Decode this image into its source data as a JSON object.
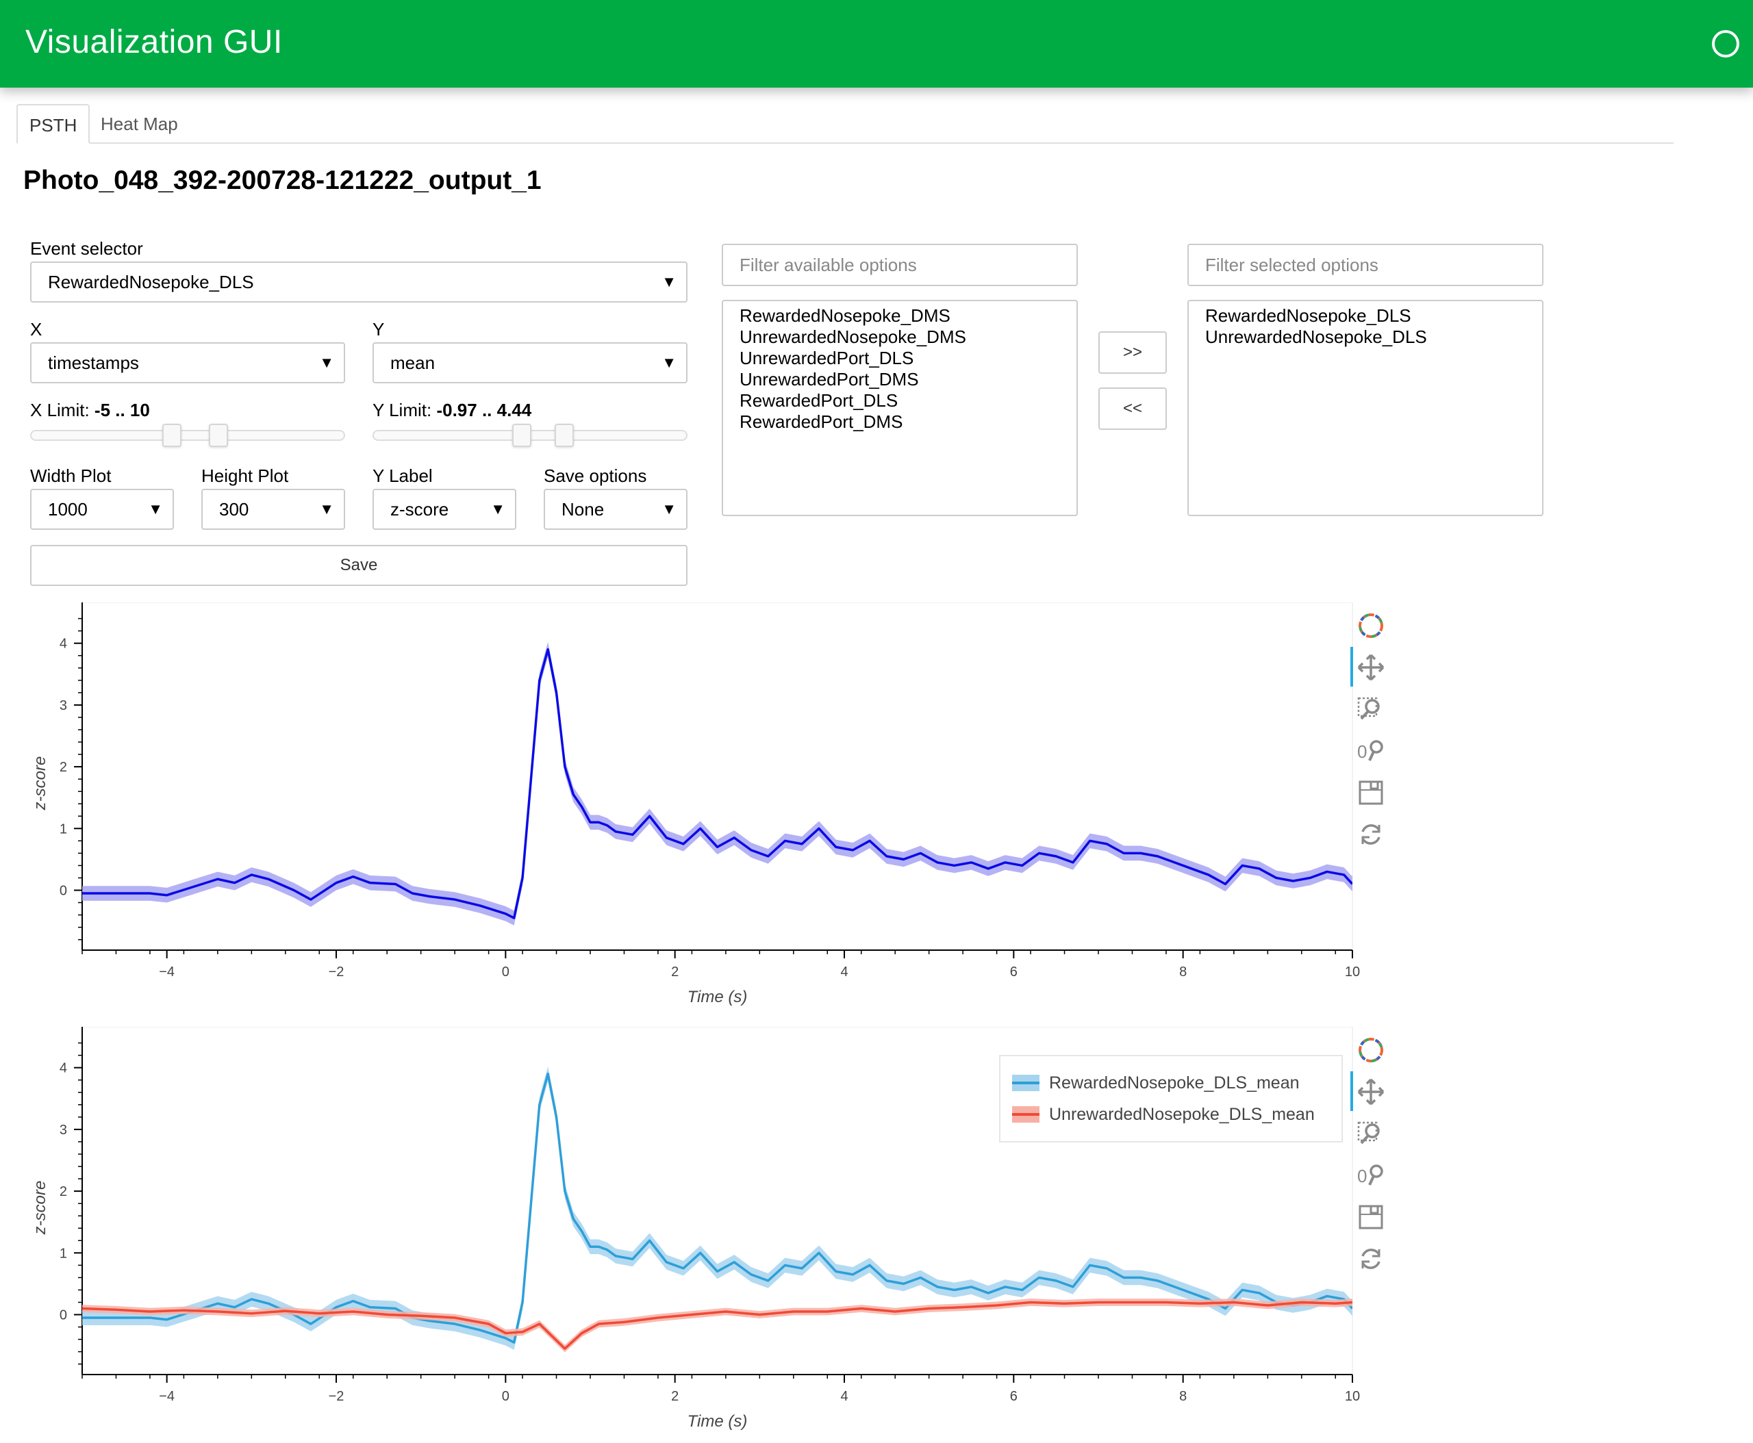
{
  "app": {
    "title": "Visualization GUI"
  },
  "tabs": [
    {
      "label": "PSTH"
    },
    {
      "label": "Heat Map"
    }
  ],
  "page_title": "Photo_048_392-200728-121222_output_1",
  "controls": {
    "event_selector": {
      "label": "Event selector",
      "value": "RewardedNosepoke_DLS"
    },
    "x": {
      "label": "X",
      "value": "timestamps"
    },
    "y": {
      "label": "Y",
      "value": "mean"
    },
    "x_limit": {
      "label": "X Limit:",
      "value": "-5 .. 10",
      "start": -5,
      "end": 10
    },
    "y_limit": {
      "label": "Y Limit:",
      "value": "-0.97 .. 4.44",
      "start": -0.97,
      "end": 4.44
    },
    "width_plot": {
      "label": "Width Plot",
      "value": "1000"
    },
    "height_plot": {
      "label": "Height Plot",
      "value": "300"
    },
    "y_label": {
      "label": "Y Label",
      "value": "z-score"
    },
    "save_options": {
      "label": "Save options",
      "value": "None"
    },
    "save_button": "Save"
  },
  "multiselect": {
    "available_placeholder": "Filter available options",
    "selected_placeholder": "Filter selected options",
    "available": [
      "RewardedNosepoke_DMS",
      "UnrewardedNosepoke_DMS",
      "UnrewardedPort_DLS",
      "UnrewardedPort_DMS",
      "RewardedPort_DLS",
      "RewardedPort_DMS"
    ],
    "selected": [
      "RewardedNosepoke_DLS",
      "UnrewardedNosepoke_DLS"
    ],
    "add_button": ">>",
    "remove_button": "<<"
  },
  "toolbar_icons": [
    "bokeh-logo-icon",
    "pan-icon",
    "box-zoom-icon",
    "wheel-zoom-icon",
    "save-icon",
    "reset-icon"
  ],
  "colors": {
    "header": "#00ab44",
    "single": "#0a0ae6",
    "rewarded": "#2e9fd8",
    "unrewarded": "#f04a36"
  },
  "chart_data": [
    {
      "type": "line",
      "xlabel": "Time (s)",
      "ylabel": "z-score",
      "xlim": [
        -5,
        10
      ],
      "ylim": [
        -0.97,
        4.44
      ],
      "xticks": [
        -4,
        -2,
        0,
        2,
        4,
        6,
        8,
        10
      ],
      "yticks": [
        0,
        1,
        2,
        3,
        4
      ],
      "series": [
        {
          "color": "#0a0ae6",
          "band_color": "#a7a4f2",
          "x": [
            -5,
            -4.5,
            -4.2,
            -4,
            -3.7,
            -3.4,
            -3.2,
            -3,
            -2.8,
            -2.5,
            -2.3,
            -2,
            -1.8,
            -1.6,
            -1.3,
            -1.1,
            -0.9,
            -0.6,
            -0.3,
            0,
            0.1,
            0.2,
            0.3,
            0.4,
            0.5,
            0.6,
            0.7,
            0.8,
            0.9,
            1,
            1.1,
            1.2,
            1.3,
            1.5,
            1.7,
            1.9,
            2.1,
            2.3,
            2.5,
            2.7,
            2.9,
            3.1,
            3.3,
            3.5,
            3.7,
            3.9,
            4.1,
            4.3,
            4.5,
            4.7,
            4.9,
            5.1,
            5.3,
            5.5,
            5.7,
            5.9,
            6.1,
            6.3,
            6.5,
            6.7,
            6.9,
            7.1,
            7.3,
            7.5,
            7.7,
            7.9,
            8.1,
            8.3,
            8.5,
            8.7,
            8.9,
            9.1,
            9.3,
            9.5,
            9.7,
            9.9,
            10
          ],
          "y": [
            -0.05,
            -0.05,
            -0.05,
            -0.08,
            0.05,
            0.18,
            0.12,
            0.25,
            0.18,
            0.0,
            -0.15,
            0.12,
            0.22,
            0.12,
            0.1,
            -0.05,
            -0.1,
            -0.15,
            -0.25,
            -0.38,
            -0.45,
            0.2,
            1.8,
            3.4,
            3.9,
            3.2,
            2.0,
            1.55,
            1.35,
            1.1,
            1.1,
            1.05,
            0.95,
            0.9,
            1.2,
            0.85,
            0.75,
            1.0,
            0.7,
            0.85,
            0.65,
            0.55,
            0.8,
            0.75,
            1.0,
            0.7,
            0.65,
            0.8,
            0.55,
            0.5,
            0.6,
            0.45,
            0.4,
            0.45,
            0.35,
            0.45,
            0.4,
            0.6,
            0.55,
            0.45,
            0.8,
            0.75,
            0.6,
            0.6,
            0.55,
            0.45,
            0.35,
            0.25,
            0.1,
            0.4,
            0.35,
            0.2,
            0.15,
            0.2,
            0.3,
            0.25,
            0.1
          ],
          "ci": 0.12
        }
      ]
    },
    {
      "type": "line",
      "xlabel": "Time (s)",
      "ylabel": "z-score",
      "xlim": [
        -5,
        10
      ],
      "ylim": [
        -0.97,
        4.44
      ],
      "xticks": [
        -4,
        -2,
        0,
        2,
        4,
        6,
        8,
        10
      ],
      "yticks": [
        0,
        1,
        2,
        3,
        4
      ],
      "legend": {
        "position": "top-right"
      },
      "series": [
        {
          "name": "RewardedNosepoke_DLS_mean",
          "color": "#2e9fd8",
          "band_color": "#a6d4ee",
          "x": [
            -5,
            -4.5,
            -4.2,
            -4,
            -3.7,
            -3.4,
            -3.2,
            -3,
            -2.8,
            -2.5,
            -2.3,
            -2,
            -1.8,
            -1.6,
            -1.3,
            -1.1,
            -0.9,
            -0.6,
            -0.3,
            0,
            0.1,
            0.2,
            0.3,
            0.4,
            0.5,
            0.6,
            0.7,
            0.8,
            0.9,
            1,
            1.1,
            1.2,
            1.3,
            1.5,
            1.7,
            1.9,
            2.1,
            2.3,
            2.5,
            2.7,
            2.9,
            3.1,
            3.3,
            3.5,
            3.7,
            3.9,
            4.1,
            4.3,
            4.5,
            4.7,
            4.9,
            5.1,
            5.3,
            5.5,
            5.7,
            5.9,
            6.1,
            6.3,
            6.5,
            6.7,
            6.9,
            7.1,
            7.3,
            7.5,
            7.7,
            7.9,
            8.1,
            8.3,
            8.5,
            8.7,
            8.9,
            9.1,
            9.3,
            9.5,
            9.7,
            9.9,
            10
          ],
          "y": [
            -0.05,
            -0.05,
            -0.05,
            -0.08,
            0.05,
            0.18,
            0.12,
            0.25,
            0.18,
            0.0,
            -0.15,
            0.12,
            0.22,
            0.12,
            0.1,
            -0.05,
            -0.1,
            -0.15,
            -0.25,
            -0.38,
            -0.45,
            0.2,
            1.8,
            3.4,
            3.9,
            3.2,
            2.0,
            1.55,
            1.35,
            1.1,
            1.1,
            1.05,
            0.95,
            0.9,
            1.2,
            0.85,
            0.75,
            1.0,
            0.7,
            0.85,
            0.65,
            0.55,
            0.8,
            0.75,
            1.0,
            0.7,
            0.65,
            0.8,
            0.55,
            0.5,
            0.6,
            0.45,
            0.4,
            0.45,
            0.35,
            0.45,
            0.4,
            0.6,
            0.55,
            0.45,
            0.8,
            0.75,
            0.6,
            0.6,
            0.55,
            0.45,
            0.35,
            0.25,
            0.1,
            0.4,
            0.35,
            0.2,
            0.15,
            0.2,
            0.3,
            0.25,
            0.1
          ],
          "ci": 0.12
        },
        {
          "name": "UnrewardedNosepoke_DLS_mean",
          "color": "#f04a36",
          "band_color": "#f7b0a6",
          "x": [
            -5,
            -4.6,
            -4.2,
            -3.8,
            -3.4,
            -3.0,
            -2.6,
            -2.2,
            -1.8,
            -1.4,
            -1.0,
            -0.6,
            -0.2,
            0,
            0.2,
            0.4,
            0.55,
            0.7,
            0.9,
            1.1,
            1.4,
            1.8,
            2.2,
            2.6,
            3.0,
            3.4,
            3.8,
            4.2,
            4.6,
            5.0,
            5.4,
            5.8,
            6.2,
            6.6,
            7.0,
            7.4,
            7.8,
            8.2,
            8.6,
            9.0,
            9.4,
            9.8,
            10
          ],
          "y": [
            0.1,
            0.08,
            0.05,
            0.07,
            0.05,
            0.02,
            0.06,
            0.02,
            0.05,
            0.0,
            -0.02,
            -0.05,
            -0.15,
            -0.3,
            -0.28,
            -0.15,
            -0.35,
            -0.55,
            -0.3,
            -0.15,
            -0.12,
            -0.05,
            0.0,
            0.05,
            0.0,
            0.05,
            0.05,
            0.1,
            0.05,
            0.1,
            0.12,
            0.15,
            0.2,
            0.18,
            0.2,
            0.2,
            0.2,
            0.18,
            0.2,
            0.15,
            0.2,
            0.18,
            0.2
          ],
          "ci": 0.06
        }
      ]
    }
  ]
}
